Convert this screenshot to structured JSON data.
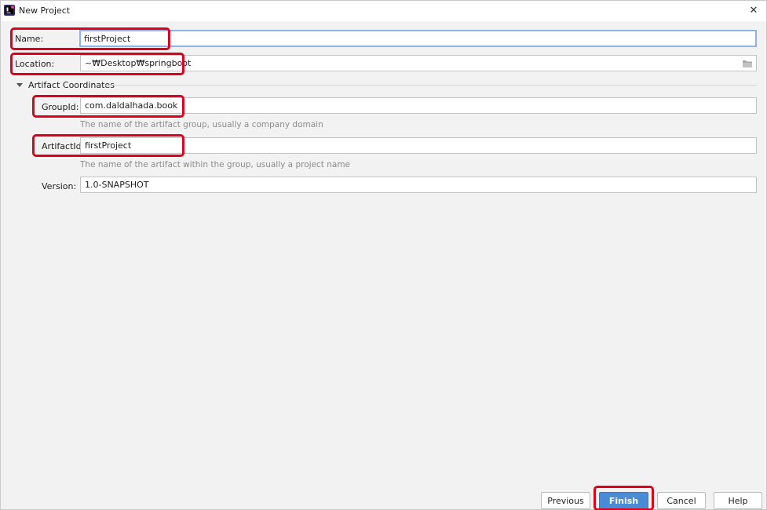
{
  "window": {
    "title": "New Project",
    "close_glyph": "✕",
    "app_icon": "intellij-icon"
  },
  "form": {
    "name": {
      "label": "Name:",
      "value": "firstProject"
    },
    "location": {
      "label": "Location:",
      "value": "~₩Desktop₩springboot",
      "browse_icon": "folder-icon"
    },
    "artifact_section": {
      "label": "Artifact Coordinates",
      "expanded": true
    },
    "group_id": {
      "label": "GroupId:",
      "value": "com.daldalhada.book",
      "hint": "The name of the artifact group, usually a company domain"
    },
    "artifact_id": {
      "label": "ArtifactId:",
      "value": "firstProject",
      "hint": "The name of the artifact within the group, usually a project name"
    },
    "version": {
      "label": "Version:",
      "value": "1.0-SNAPSHOT"
    }
  },
  "buttons": {
    "previous": "Previous",
    "finish": "Finish",
    "cancel": "Cancel",
    "help": "Help"
  },
  "colors": {
    "highlight": "#e0001b",
    "primary": "#4a8bd6",
    "focus_border": "#8fb3e6"
  }
}
